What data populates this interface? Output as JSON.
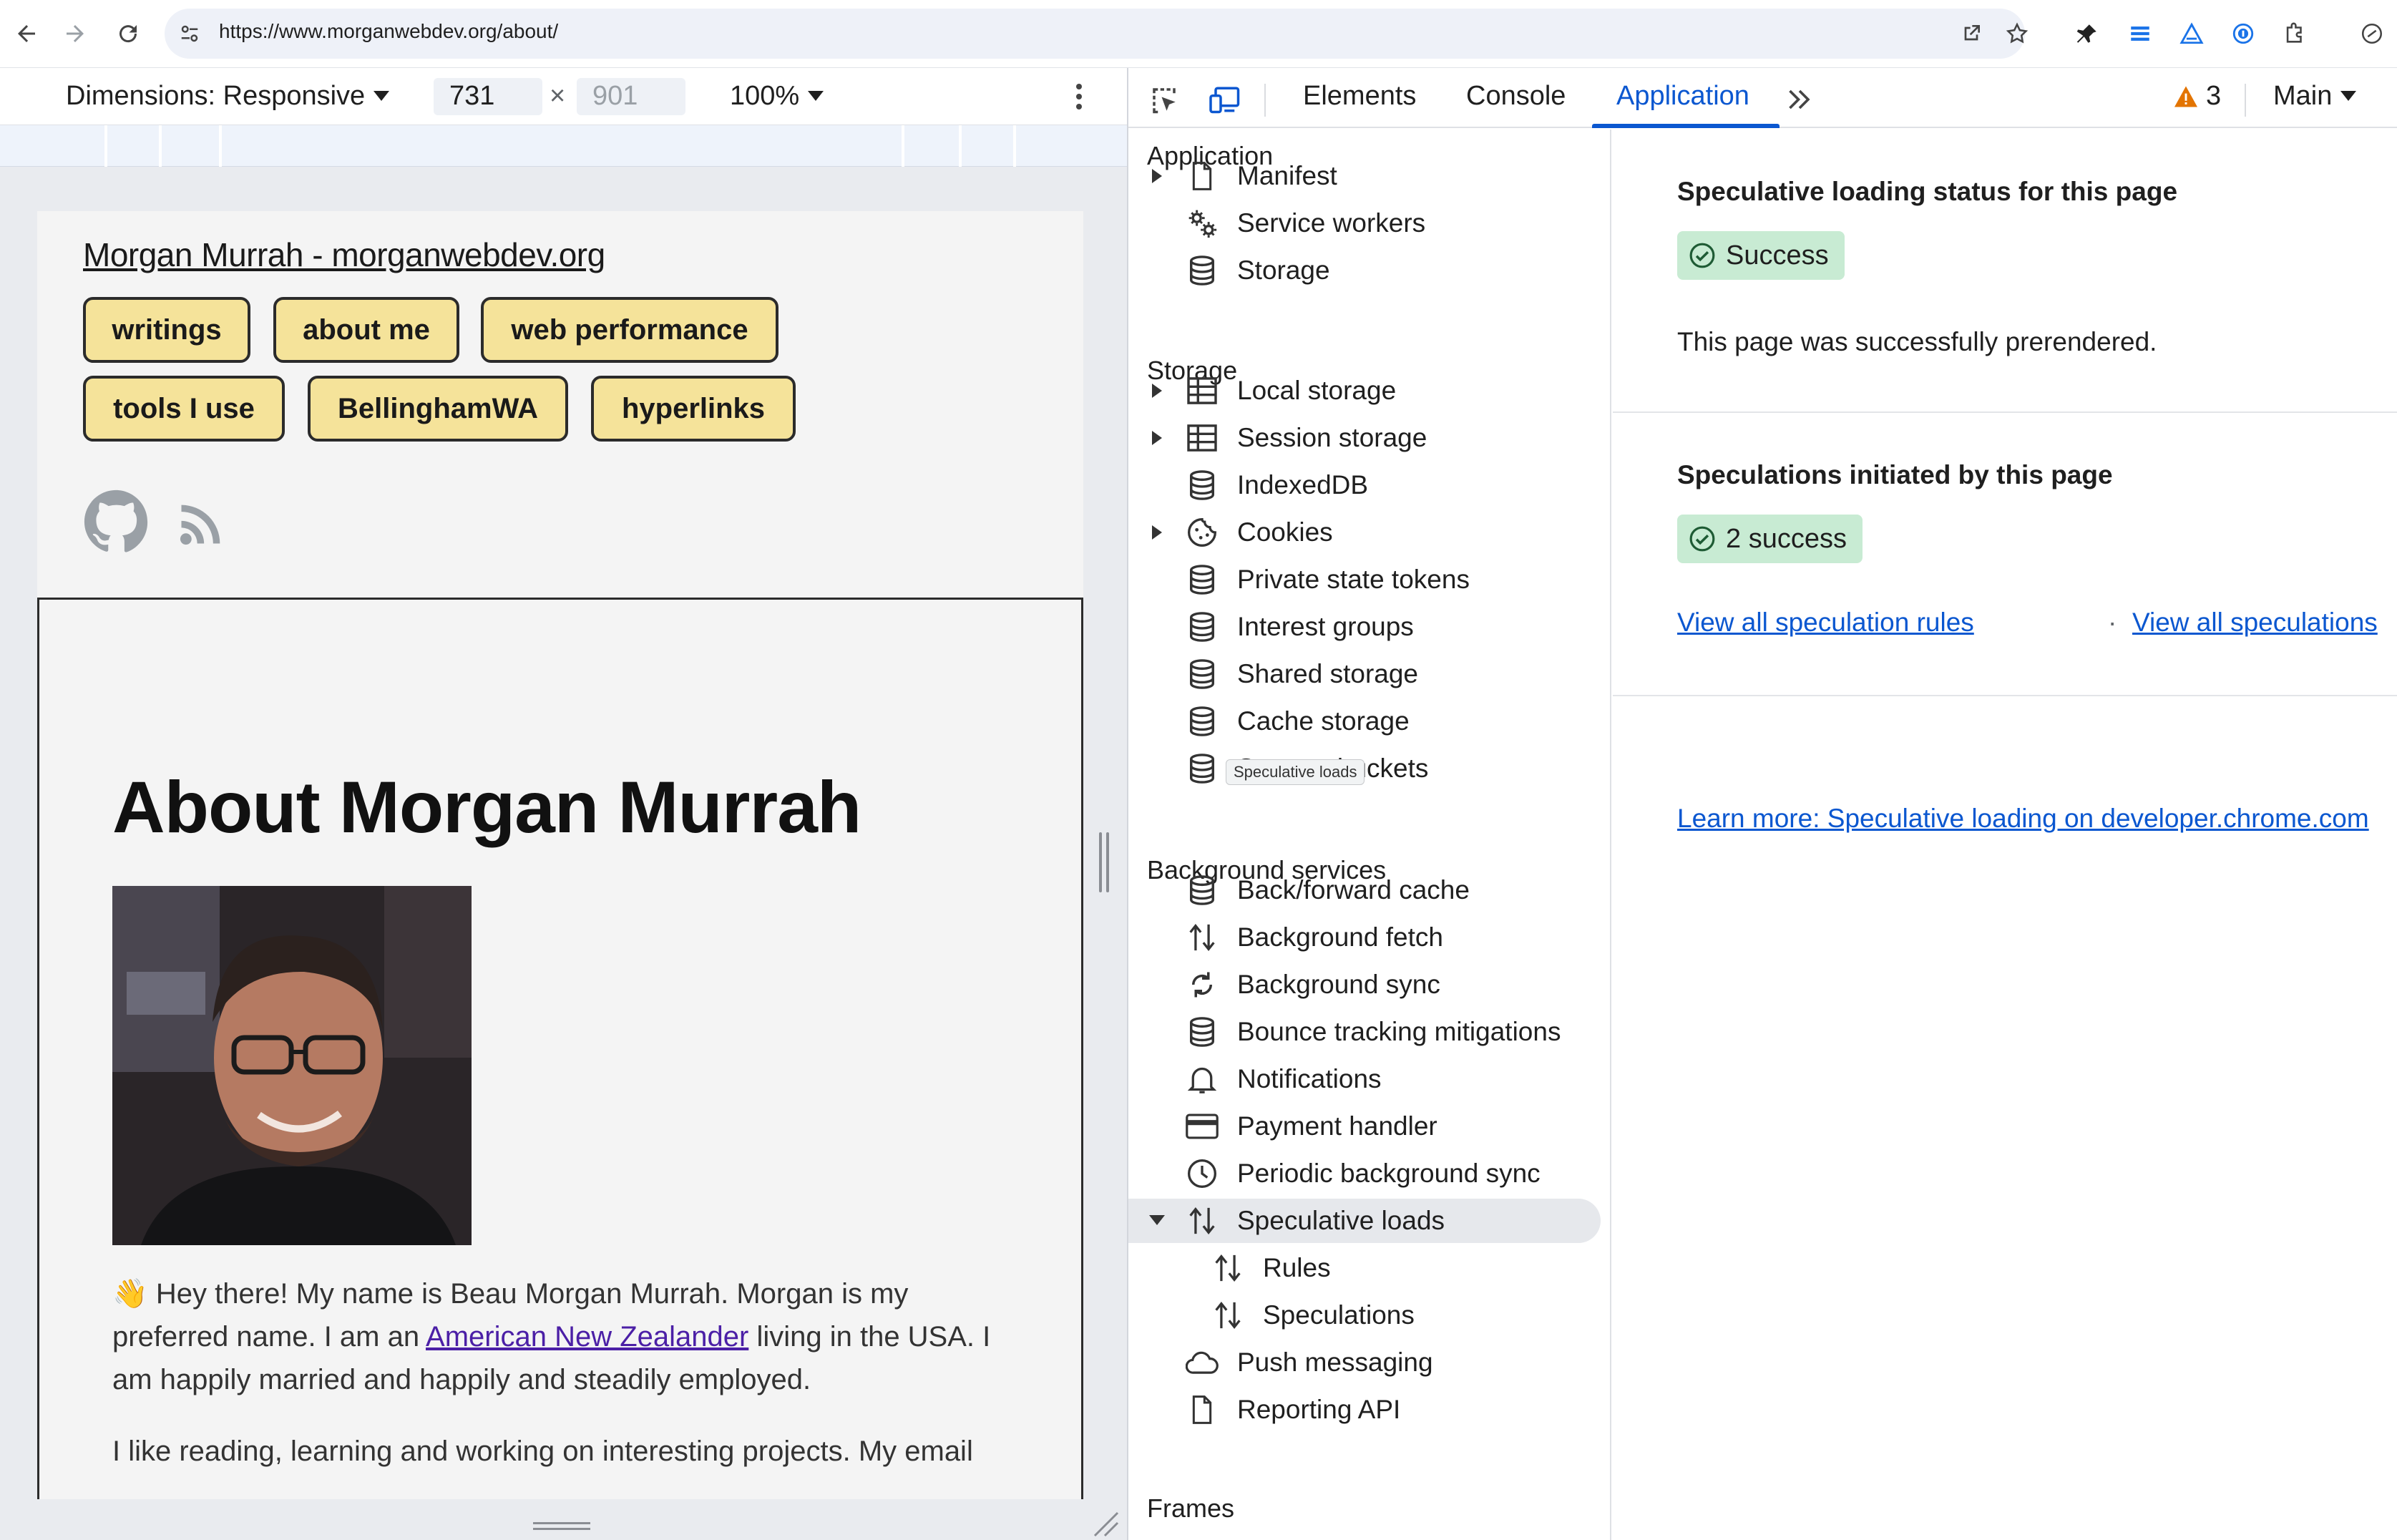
{
  "browser": {
    "url": "https://www.morganwebdev.org/about/"
  },
  "device_toolbar": {
    "dimensions_label": "Dimensions: Responsive",
    "width": "731",
    "height": "901",
    "times": "×",
    "zoom": "100%"
  },
  "page": {
    "site_title": "Morgan Murrah - morganwebdev.org",
    "nav": [
      "writings",
      "about me",
      "web performance",
      "tools I use",
      "BellinghamWA",
      "hyperlinks"
    ],
    "heading": "About Morgan Murrah",
    "para1_part1": "👋 Hey there! My name is Beau Morgan Murrah. Morgan is my preferred name. I am an ",
    "para1_link": "American New Zealander",
    "para1_part2": " living in the USA. I am happily married and happily and steadily employed.",
    "para2": "I like reading, learning and working on interesting projects. My email"
  },
  "devtools": {
    "tabs": {
      "elements": "Elements",
      "console": "Console",
      "application": "Application"
    },
    "warning_count": "3",
    "target": "Main",
    "sidebar": {
      "application_header": "Application",
      "application_items": [
        "Manifest",
        "Service workers",
        "Storage"
      ],
      "storage_header": "Storage",
      "storage_items": [
        "Local storage",
        "Session storage",
        "IndexedDB",
        "Cookies",
        "Private state tokens",
        "Interest groups",
        "Shared storage",
        "Cache storage",
        "Storage buckets"
      ],
      "background_header": "Background services",
      "background_items": [
        "Back/forward cache",
        "Background fetch",
        "Background sync",
        "Bounce tracking mitigations",
        "Notifications",
        "Payment handler",
        "Periodic background sync",
        "Speculative loads",
        "Rules",
        "Speculations",
        "Push messaging",
        "Reporting API"
      ],
      "frames_header": "Frames",
      "tooltip": "Speculative loads"
    },
    "main": {
      "status_heading": "Speculative loading status for this page",
      "status_chip": "Success",
      "status_text": "This page was successfully prerendered.",
      "speculations_heading": "Speculations initiated by this page",
      "speculations_chip": "2 success",
      "link_rules": "View all speculation rules",
      "link_separator": "·",
      "link_speculations": "View all speculations",
      "learn_more": "Learn more: Speculative loading on developer.chrome.com"
    }
  },
  "colors": {
    "accent": "#0b57d0",
    "nav_pill": "#f5e39a",
    "success_chip": "#c8ebd3",
    "warning": "#e37400"
  }
}
